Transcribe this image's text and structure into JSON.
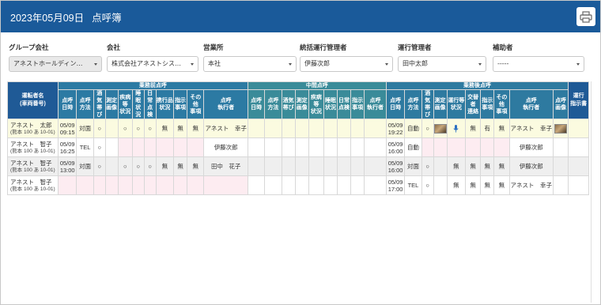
{
  "header": {
    "date": "2023年05月09日",
    "title": "点呼簿"
  },
  "filters": [
    {
      "label": "グループ会社",
      "value": "アネストホールディン…",
      "disabled": true
    },
    {
      "label": "会社",
      "value": "株式会社アネストシス…",
      "disabled": false
    },
    {
      "label": "営業所",
      "value": "本社",
      "disabled": false
    },
    {
      "label": "統括運行管理者",
      "value": "伊藤次郎",
      "disabled": false
    },
    {
      "label": "運行管理者",
      "value": "田中太郎",
      "disabled": false
    },
    {
      "label": "補助者",
      "value": "-----",
      "disabled": false
    }
  ],
  "table": {
    "groups": {
      "driver": "運転者名\n(車両番号)",
      "pre": "乗務前点呼",
      "mid": "中間点呼",
      "post": "乗務後点呼",
      "bd": "運行\n指示書"
    },
    "pre_cols": [
      "点呼\n日時",
      "点呼\n方法",
      "酒気\n帯び",
      "測定\n画像",
      "疾病等\n状況",
      "睡眠\n状況",
      "日常\n点検",
      "携行品\n状況",
      "指示\n事項",
      "その他\n事項",
      "点呼\n執行者"
    ],
    "mid_cols": [
      "点呼\n日時",
      "点呼\n方法",
      "酒気\n帯び",
      "測定\n画像",
      "疾病等\n状況",
      "睡眠\n状況",
      "日常\n点検",
      "指示\n事項",
      "点呼\n執行者"
    ],
    "post_cols": [
      "点呼\n日時",
      "点呼\n方法",
      "酒気\n帯び",
      "測定\n画像",
      "運行等\n状況",
      "交替者\n連絡",
      "指示\n事項",
      "その他\n事項",
      "点呼\n執行者",
      "点呼\n画像"
    ],
    "rows": [
      {
        "driver": "アネスト　太郎",
        "plate": "(熊本 100 あ 10-01)",
        "pre": {
          "dt": "05/09\n09:15",
          "method": "対面",
          "alcohol": "○",
          "img": "",
          "illness": "○",
          "sleep": "○",
          "check": "○",
          "items": "無",
          "instr": "無",
          "other": "無",
          "exec": "アネスト　幸子"
        },
        "post": {
          "dt": "05/09\n19:22",
          "method": "自動",
          "alcohol": "○",
          "img": "thumb",
          "status": "mic",
          "relief": "無",
          "instr": "有",
          "other": "無",
          "exec": "アネスト　幸子",
          "photo": "thumb"
        }
      },
      {
        "driver": "アネスト　智子",
        "plate": "(熊本 100 あ 10-01)",
        "pre": {
          "dt": "05/09\n16:25",
          "method": "TEL",
          "alcohol": "○",
          "img": "",
          "illness": "",
          "sleep": "",
          "check": "",
          "items": "",
          "instr": "",
          "other": "",
          "exec": "伊藤次郎"
        },
        "post": {
          "dt": "05/09\n16:00",
          "method": "自動",
          "alcohol": "",
          "img": "",
          "status": "",
          "relief": "",
          "instr": "",
          "other": "",
          "exec": "伊藤次郎",
          "photo": ""
        }
      },
      {
        "driver": "アネスト　智子",
        "plate": "(熊本 100 あ 10-01)",
        "pre": {
          "dt": "05/09\n13:00",
          "method": "対面",
          "alcohol": "○",
          "img": "",
          "illness": "○",
          "sleep": "○",
          "check": "○",
          "items": "無",
          "instr": "無",
          "other": "無",
          "exec": "田中　花子"
        },
        "post": {
          "dt": "05/09\n16:00",
          "method": "対面",
          "alcohol": "○",
          "img": "",
          "status": "無",
          "relief": "無",
          "instr": "無",
          "other": "無",
          "exec": "伊藤次郎",
          "photo": ""
        }
      },
      {
        "driver": "アネスト　智子",
        "plate": "(熊本 100 あ 10-01)",
        "pre": {
          "dt": "",
          "method": "",
          "alcohol": "",
          "img": "",
          "illness": "",
          "sleep": "",
          "check": "",
          "items": "",
          "instr": "",
          "other": "",
          "exec": ""
        },
        "post": {
          "dt": "05/09\n17:00",
          "method": "TEL",
          "alcohol": "○",
          "img": "",
          "status": "無",
          "relief": "無",
          "instr": "無",
          "other": "無",
          "exec": "アネスト　幸子",
          "photo": ""
        }
      }
    ]
  },
  "colors": {
    "header": "#1a5a9a",
    "pre": "#2c7aa3",
    "mid": "#3a8b99",
    "post": "#2e7aa0"
  }
}
